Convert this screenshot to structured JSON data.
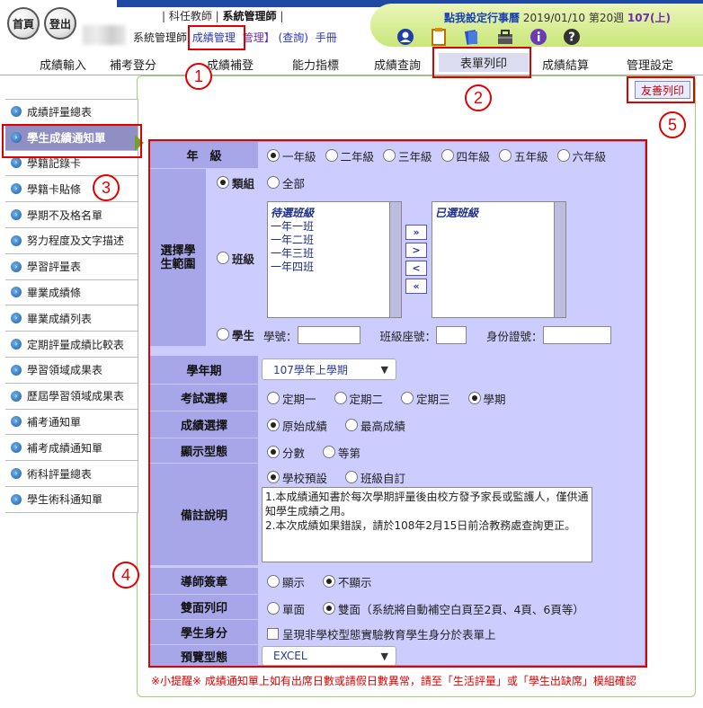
{
  "header": {
    "home_label": "首頁",
    "logout_label": "登出",
    "role_prefix": "| 科任教師 |",
    "role_admin": "系統管理師",
    "role_suffix": "|",
    "sys_admin": "系統管理師",
    "module_name": "成績管理",
    "bracket_manage": "管理】",
    "query_label": "(查詢)",
    "manual_label": "手冊",
    "todo_label": "點我設定行事曆",
    "date_week": "2019/01/10 第20週",
    "term": "107(上)"
  },
  "nav": {
    "tabs": [
      "成績輸入",
      "補考登分",
      "成績補登",
      "能力指標",
      "成績查詢",
      "表單列印",
      "成績結算",
      "管理設定"
    ],
    "active": "表單列印"
  },
  "sidebar": {
    "items": [
      "成績評量總表",
      "學生成績通知單",
      "學籍記錄卡",
      "學籍卡貼條",
      "學期不及格名單",
      "努力程度及文字描述",
      "學習評量表",
      "畢業成績條",
      "畢業成績列表",
      "定期評量成績比較表",
      "學習領域成果表",
      "歷屆學習領域成果表",
      "補考通知單",
      "補考成績通知單",
      "術科評量總表",
      "學生術科通知單"
    ],
    "active_index": 1
  },
  "print_button": "友善列印",
  "annotations": [
    "1",
    "2",
    "3",
    "4",
    "5"
  ],
  "form": {
    "grade_label": "年　級",
    "grades": [
      "一年級",
      "二年級",
      "三年級",
      "四年級",
      "五年級",
      "六年級"
    ],
    "grade_selected": "一年級",
    "scope_label": "選擇學生範圍",
    "group_label": "類組",
    "group_all": "全部",
    "class_label": "班級",
    "pending_title": "待選班級",
    "pending_classes": [
      "一年一班",
      "一年二班",
      "一年三班",
      "一年四班"
    ],
    "selected_title": "已選班級",
    "move_buttons": [
      "»",
      ">",
      "<",
      "«"
    ],
    "student_label": "學生",
    "student_no_label": "學號：",
    "seat_label": "班級座號：",
    "id_label": "身份證號：",
    "year_term_label": "學年期",
    "year_term_value": "107學年上學期",
    "exam_label": "考試選擇",
    "exams": [
      "定期一",
      "定期二",
      "定期三",
      "學期"
    ],
    "exam_selected": "學期",
    "score_label": "成績選擇",
    "scores": [
      "原始成績",
      "最高成績"
    ],
    "score_selected": "原始成績",
    "display_label": "顯示型態",
    "displays": [
      "分數",
      "等第"
    ],
    "display_selected": "分數",
    "note_label": "備註說明",
    "note_options": [
      "學校預設",
      "班級自訂"
    ],
    "note_selected": "學校預設",
    "note_text": "1.本成績通知書於每次學期評量後由校方發予家長或監護人，僅供通知學生成績之用。\n2.本次成績如果錯誤，請於108年2月15日前洽教務處查詢更正。",
    "stamp_label": "導師簽章",
    "stamps": [
      "顯示",
      "不顯示"
    ],
    "stamp_selected": "不顯示",
    "duplex_label": "雙面列印",
    "duplex_single": "單面",
    "duplex_double": "雙面（系統將自動補空白頁至2頁、4頁、6頁等）",
    "duplex_selected": "雙面",
    "identity_label": "學生身分",
    "identity_check": "呈現非學校型態實驗教育學生身分於表單上",
    "preview_label": "預覽型態",
    "preview_value": "EXCEL"
  },
  "reminder": "※小提醒※ 成績通知單上如有出席日數或請假日數異常，請至「生活評量」或「學生出缺席」模組確認"
}
